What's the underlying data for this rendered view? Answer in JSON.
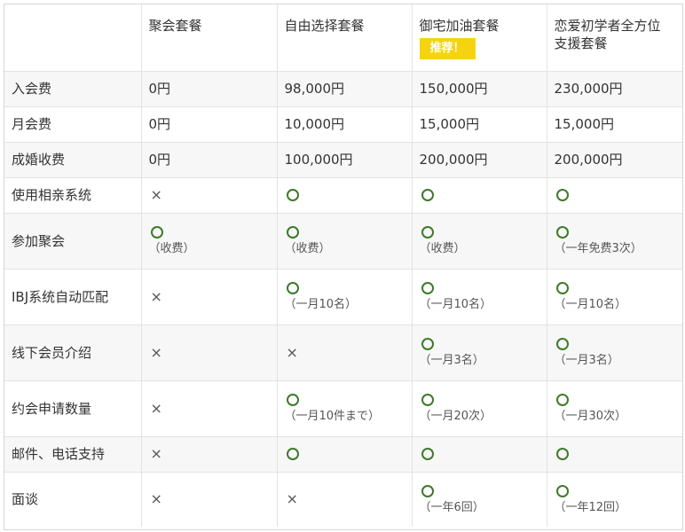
{
  "header": {
    "blank": "",
    "plans": [
      {
        "name": "聚会套餐"
      },
      {
        "name": "自由选择套餐"
      },
      {
        "name": "御宅加油套餐",
        "badge": "推荐！"
      },
      {
        "name": "恋爱初学者全方位支援套餐"
      }
    ]
  },
  "rows": [
    {
      "label": "入会费",
      "cells": [
        {
          "text": "0円"
        },
        {
          "text": "98,000円"
        },
        {
          "text": "150,000円"
        },
        {
          "text": "230,000円"
        }
      ]
    },
    {
      "label": "月会费",
      "cells": [
        {
          "text": "0円"
        },
        {
          "text": "10,000円"
        },
        {
          "text": "15,000円"
        },
        {
          "text": "15,000円"
        }
      ]
    },
    {
      "label": "成婚收费",
      "cells": [
        {
          "text": "0円"
        },
        {
          "text": "100,000円"
        },
        {
          "text": "200,000円"
        },
        {
          "text": "200,000円"
        }
      ]
    },
    {
      "label": "使用相亲系统",
      "cells": [
        {
          "mark": "×"
        },
        {
          "mark": "○"
        },
        {
          "mark": "○"
        },
        {
          "mark": "○"
        }
      ]
    },
    {
      "label": "参加聚会",
      "cells": [
        {
          "mark": "○",
          "note": "（收费）"
        },
        {
          "mark": "○",
          "note": "（收费）"
        },
        {
          "mark": "○",
          "note": "（收费）"
        },
        {
          "mark": "○",
          "note": "（一年免费3次）"
        }
      ]
    },
    {
      "label": "IBJ系统自动匹配",
      "cells": [
        {
          "mark": "×"
        },
        {
          "mark": "○",
          "note": "（一月10名）"
        },
        {
          "mark": "○",
          "note": "（一月10名）"
        },
        {
          "mark": "○",
          "note": "（一月10名）"
        }
      ]
    },
    {
      "label": "线下会员介绍",
      "cells": [
        {
          "mark": "×"
        },
        {
          "mark": "×"
        },
        {
          "mark": "○",
          "note": "（一月3名）"
        },
        {
          "mark": "○",
          "note": "（一月3名）"
        }
      ]
    },
    {
      "label": "约会申请数量",
      "cells": [
        {
          "mark": "×"
        },
        {
          "mark": "○",
          "note": "（一月10件まで）"
        },
        {
          "mark": "○",
          "note": "（一月20次）"
        },
        {
          "mark": "○",
          "note": "（一月30次）"
        }
      ]
    },
    {
      "label": "邮件、电话支持",
      "cells": [
        {
          "mark": "×"
        },
        {
          "mark": "○"
        },
        {
          "mark": "○"
        },
        {
          "mark": "○"
        }
      ]
    },
    {
      "label": "面谈",
      "cells": [
        {
          "mark": "×"
        },
        {
          "mark": "×"
        },
        {
          "mark": "○",
          "note": "（一年6回）"
        },
        {
          "mark": "○",
          "note": "（一年12回）"
        }
      ]
    }
  ]
}
